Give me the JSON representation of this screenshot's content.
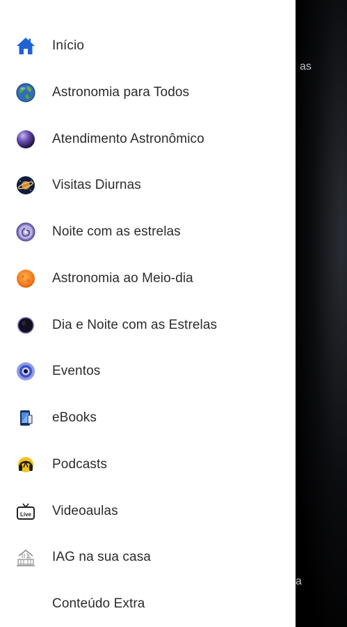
{
  "drawer": {
    "items": [
      {
        "label": "Início",
        "icon": "home-icon"
      },
      {
        "label": "Astronomia para Todos",
        "icon": "earth-globe-icon"
      },
      {
        "label": "Atendimento Astronômico",
        "icon": "purple-planet-icon"
      },
      {
        "label": "Visitas Diurnas",
        "icon": "ringed-planet-icon"
      },
      {
        "label": "Noite com as estrelas",
        "icon": "spiral-galaxy-icon"
      },
      {
        "label": "Astronomia ao Meio-dia",
        "icon": "sun-icon"
      },
      {
        "label": "Dia e Noite com as Estrelas",
        "icon": "dark-moon-icon"
      },
      {
        "label": "Eventos",
        "icon": "blue-ring-icon"
      },
      {
        "label": "eBooks",
        "icon": "ebook-phone-icon"
      },
      {
        "label": "Podcasts",
        "icon": "podcast-headphones-icon"
      },
      {
        "label": "Videoaulas",
        "icon": "live-tv-icon"
      },
      {
        "label": "IAG na sua casa",
        "icon": "iag-building-icon"
      },
      {
        "label": "Conteúdo Extra",
        "icon": ""
      }
    ]
  },
  "background": {
    "peek_top": "as",
    "peek_bottom": "a"
  },
  "colors": {
    "drawer_bg": "#ffffff",
    "label": "#2b2b2b",
    "home_icon": "#1e63d6",
    "scrim": "#000000"
  }
}
